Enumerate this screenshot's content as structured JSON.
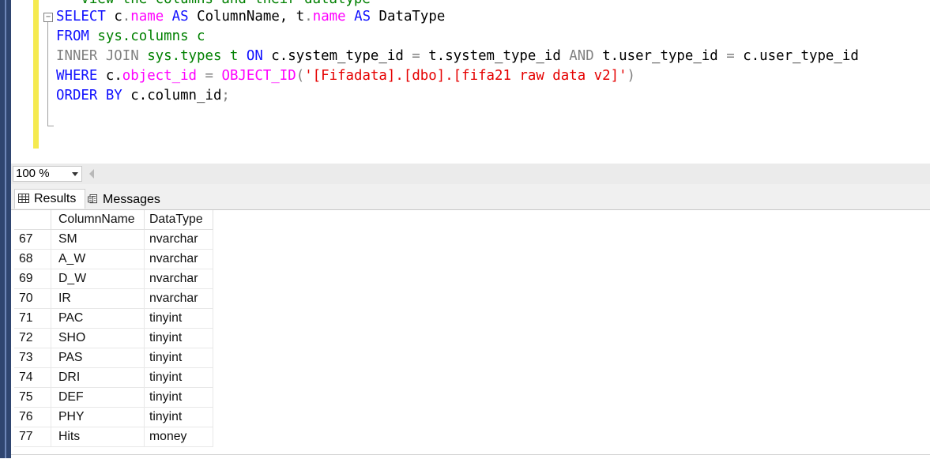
{
  "editor": {
    "line0": {
      "partial_comment": "-- View the columns and their datatype"
    },
    "line1": {
      "select": "SELECT",
      "c": "c",
      "dot1": ".",
      "name1": "name",
      "as1": "AS",
      "alias1": "ColumnName,",
      "t": "t",
      "dot2": ".",
      "name2": "name",
      "as2": "AS",
      "alias2": "DataType"
    },
    "line2": {
      "from": "FROM",
      "rest": "sys.columns c"
    },
    "line3": {
      "inner_join": "INNER JOIN",
      "types": "sys.types t",
      "on": "ON",
      "cond1": "c.system_type_id",
      "eq1": "=",
      "cond2": "t.system_type_id",
      "and": "AND",
      "cond3": "t.user_type_id",
      "eq2": "=",
      "cond4": "c.user_type_id"
    },
    "line4": {
      "where": "WHERE",
      "c": "c.",
      "object_id": "object_id",
      "eq": "=",
      "func": "OBJECT_ID",
      "paren_open": "(",
      "literal": "'[Fifadata].[dbo].[fifa21 raw data v2]'",
      "paren_close": ")"
    },
    "line5": {
      "order_by": "ORDER BY",
      "col": "c.column_id",
      "semi": ";"
    }
  },
  "zoom": {
    "value": "100 %"
  },
  "tabs": {
    "results": "Results",
    "messages": "Messages"
  },
  "grid": {
    "headers": [
      "",
      "ColumnName",
      "DataType"
    ],
    "rows": [
      [
        "67",
        "SM",
        "nvarchar"
      ],
      [
        "68",
        "A_W",
        "nvarchar"
      ],
      [
        "69",
        "D_W",
        "nvarchar"
      ],
      [
        "70",
        "IR",
        "nvarchar"
      ],
      [
        "71",
        "PAC",
        "tinyint"
      ],
      [
        "72",
        "SHO",
        "tinyint"
      ],
      [
        "73",
        "PAS",
        "tinyint"
      ],
      [
        "74",
        "DRI",
        "tinyint"
      ],
      [
        "75",
        "DEF",
        "tinyint"
      ],
      [
        "76",
        "PHY",
        "tinyint"
      ],
      [
        "77",
        "Hits",
        "money"
      ]
    ]
  },
  "icons": {
    "results": "grid-icon",
    "messages": "messages-icon",
    "zoom_dropdown": "chevron-down-icon",
    "scroll_left": "scroll-left-arrow-icon",
    "collapse": "collapse-minus-icon"
  },
  "colors": {
    "keyword": "#1010ff",
    "function": "#ff00ff",
    "string": "#e50000",
    "comment": "#008000",
    "operator": "#808080",
    "change_margin": "#f5ea4f"
  }
}
